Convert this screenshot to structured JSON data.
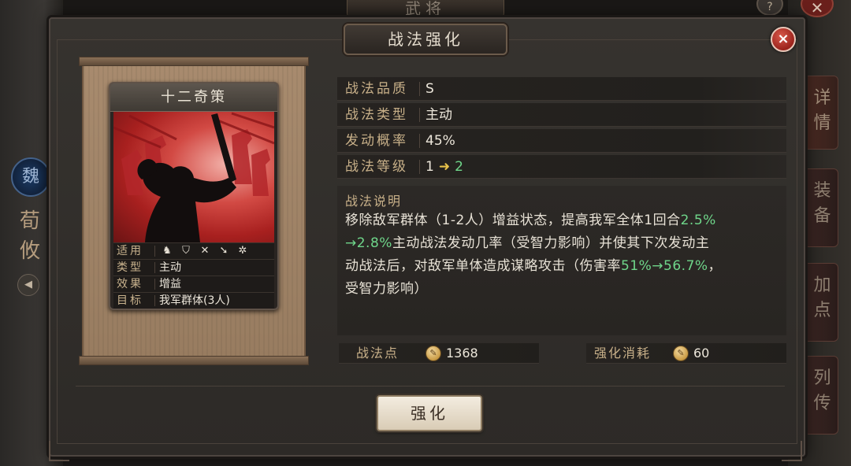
{
  "background": {
    "top_tab": "武将",
    "help_icon": "?",
    "general": {
      "faction": "魏",
      "name": "荀攸"
    },
    "side_tabs": [
      "详情",
      "装备",
      "加点",
      "列传"
    ]
  },
  "dialog": {
    "title": "战法强化",
    "close_icon": "×"
  },
  "card": {
    "name": "十二奇策",
    "attrs": {
      "suitable_label": "适用",
      "type_label": "类型",
      "type_value": "主动",
      "effect_label": "效果",
      "effect_value": "增益",
      "target_label": "目标",
      "target_value": "我军群体(3人)"
    },
    "troop_icons": [
      "cavalry-icon",
      "shield-icon",
      "bow-icon",
      "spear-icon",
      "chariot-icon"
    ]
  },
  "info": {
    "quality_label": "战法品质",
    "quality_value": "S",
    "type_label": "战法类型",
    "type_value": "主动",
    "rate_label": "发动概率",
    "rate_value": "45%",
    "level_label": "战法等级",
    "level_from": "1",
    "level_to": "2"
  },
  "description": {
    "title": "战法说明",
    "p1": "移除敌军群体（1-2人）增益状态，提高我军全体1回合",
    "p1_g1": "2.5%",
    "p2_g1": "→2.8%",
    "p2": "主动战法发动几率（受智力影响）并使其下次发动主",
    "p3": "动战法后，对敌军单体造成谋略攻击（伤害率",
    "p3_g1": "51%→56.7%",
    "p3_end": "，",
    "p4": "受智力影响）"
  },
  "points": {
    "label": "战法点",
    "value": "1368",
    "cost_label": "强化消耗",
    "cost_value": "60"
  },
  "button": {
    "upgrade": "强化"
  },
  "colors": {
    "highlight_green": "#6fd68a",
    "label_gold": "#c8b089",
    "close_red": "#b8342a"
  }
}
